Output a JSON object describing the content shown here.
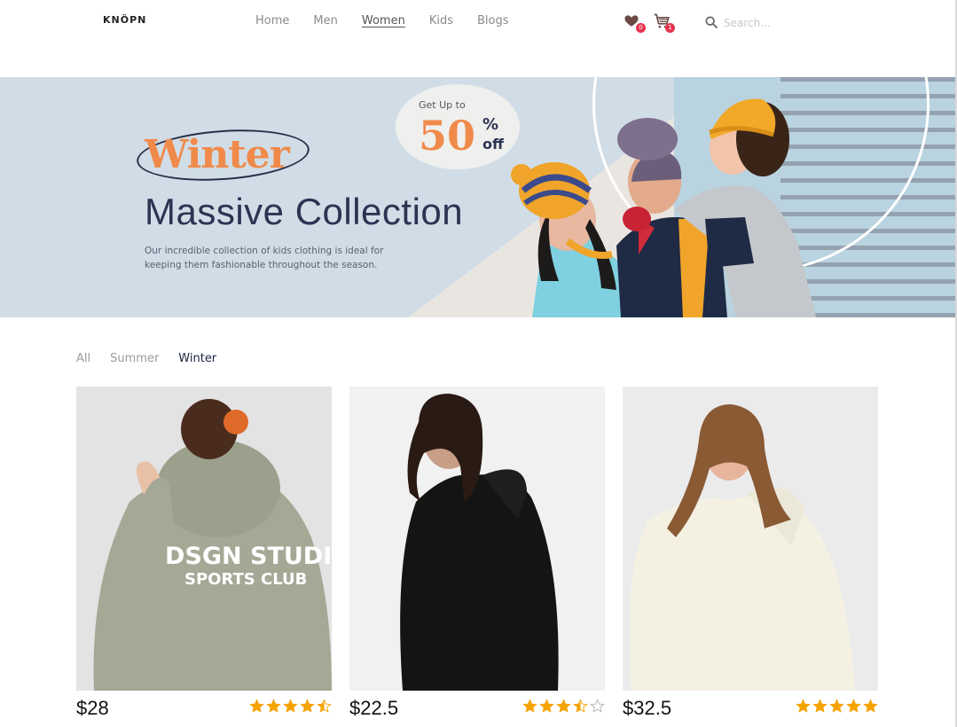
{
  "header": {
    "logo": "KNÖPN",
    "nav": [
      "Home",
      "Men",
      "Women",
      "Kids",
      "Blogs"
    ],
    "active_nav": "Women",
    "wishlist_count": "0",
    "cart_count": "1",
    "search_placeholder": "Search..."
  },
  "banner": {
    "headline_1": "Winter",
    "headline_2": "Massive Collection",
    "description": "Our incredible collection of kids clothing is ideal for keeping them fashionable throughout the season.",
    "promo_prefix": "Get Up to",
    "promo_value": "50",
    "promo_percent": "%",
    "promo_suffix": "off"
  },
  "filters": [
    "All",
    "Summer",
    "Winter"
  ],
  "active_filter": "Winter",
  "products": [
    {
      "price": "$28",
      "rating": 4.5,
      "hoodie_text_1": "DSGN STUDIO.",
      "hoodie_text_2": "SPORTS CLUB"
    },
    {
      "price": "$22.5",
      "rating": 3.5
    },
    {
      "price": "$32.5",
      "rating": 5
    }
  ],
  "colors": {
    "accent_orange": "#f08a4b",
    "navy": "#2c3453",
    "badge_red": "#e8344e",
    "star_gold": "#f5a300",
    "banner_bg": "#d1dde6"
  },
  "icons": [
    "heart-icon",
    "cart-icon",
    "search-icon",
    "star-icon"
  ]
}
